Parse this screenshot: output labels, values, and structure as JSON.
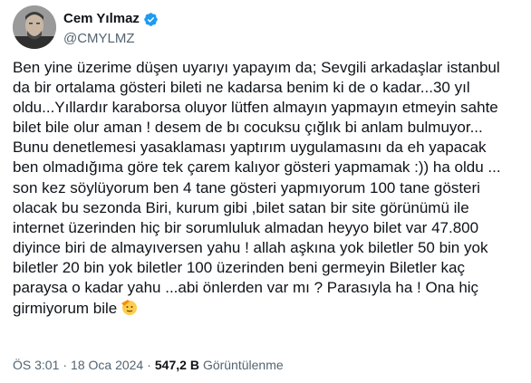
{
  "author": {
    "display_name": "Cem Yılmaz",
    "handle": "@CMYLMZ",
    "verified": true,
    "avatar_icon": "profile-photo",
    "verified_color": "#1d9bf0"
  },
  "tweet": {
    "text": "Ben yine üzerime düşen uyarıyı yapayım da; Sevgili arkadaşlar istanbul\nda bir ortalama gösteri bileti ne kadarsa benim ki de o kadar...30 yıl\noldu...Yıllardır karaborsa oluyor lütfen almayın yapmayın etmeyin sahte\nbilet bile olur aman ! desem de bı cocuksu çığlık bi anlam bulmuyor...\nBunu denetlemesi yasaklaması yaptırım uygulamasını da eh yapacak\nben olmadığıma göre tek çarem kalıyor gösteri yapmamak :)) ha oldu ...\nson kez söylüyorum ben 4 tane gösteri yapmıyorum 100 tane gösteri\nolacak  bu sezonda Biri,  kurum gibi ,bilet satan bir site görünümü ile\ninternet üzerinden hiç bir sorumluluk almadan heyyo bilet var 47.800\ndiyince biri de almayıversen yahu !  allah aşkına yok biletler 50 bin yok\nbiletler 20 bin yok biletler 100 üzerinden beni germeyin Biletler kaç\nparaysa o kadar yahu ...abi önlerden var mı ? Parasıyla ha ! Ona hiç\ngirmiyorum bile",
    "trailing_emoji": "saluting-face-emoji"
  },
  "meta": {
    "time": "ÖS 3:01",
    "separator": "·",
    "date": "18 Oca 2024",
    "views_count": "547,2 B",
    "views_label": "Görüntülenme"
  },
  "colors": {
    "text": "#0f1419",
    "secondary": "#536471",
    "accent": "#1d9bf0"
  }
}
